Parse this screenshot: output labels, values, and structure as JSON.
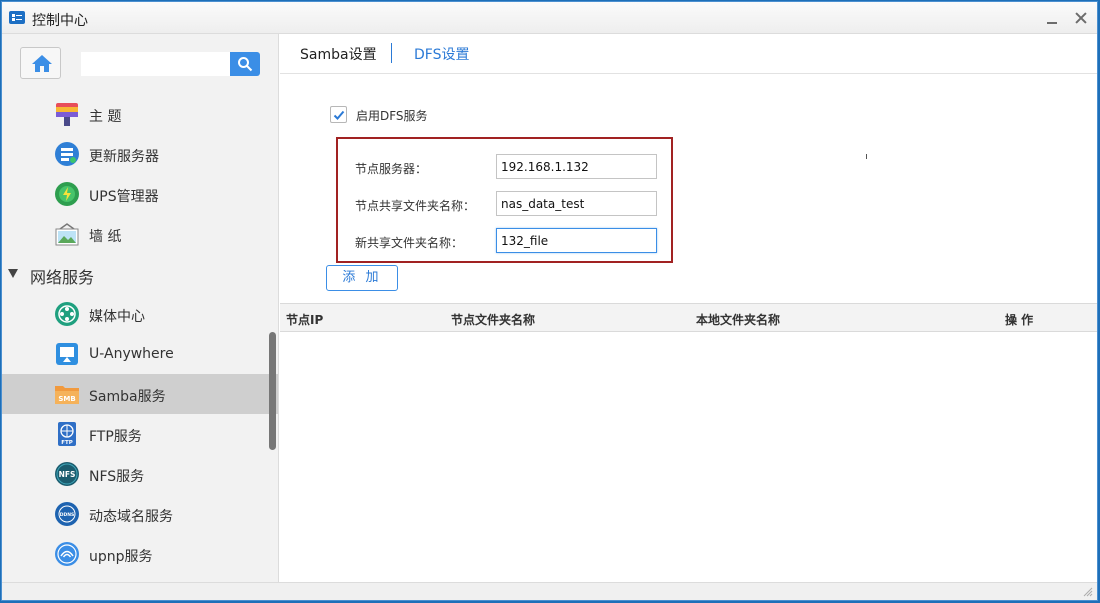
{
  "window": {
    "title": "控制中心"
  },
  "sidebar": {
    "search_placeholder": "",
    "items_top": [
      {
        "label": "主 题",
        "icon": "theme-icon"
      },
      {
        "label": "更新服务器",
        "icon": "update-server-icon"
      },
      {
        "label": "UPS管理器",
        "icon": "ups-icon"
      },
      {
        "label": "墙 纸",
        "icon": "wallpaper-icon"
      }
    ],
    "group": {
      "label": "网络服务",
      "expanded": true
    },
    "items_network": [
      {
        "label": "媒体中心",
        "icon": "media-center-icon"
      },
      {
        "label": "U-Anywhere",
        "icon": "u-anywhere-icon"
      },
      {
        "label": "Samba服务",
        "icon": "smb-icon",
        "icon_text": "SMB",
        "active": true
      },
      {
        "label": "FTP服务",
        "icon": "ftp-icon",
        "icon_text": "FTP"
      },
      {
        "label": "NFS服务",
        "icon": "nfs-icon",
        "icon_text": "NFS"
      },
      {
        "label": "动态域名服务",
        "icon": "ddns-icon",
        "icon_text": "DDNS"
      },
      {
        "label": "upnp服务",
        "icon": "upnp-icon"
      }
    ]
  },
  "tabs": [
    {
      "label": "Samba设置",
      "active": false
    },
    {
      "label": "DFS设置",
      "active": true
    }
  ],
  "dfs": {
    "enable_label": "启用DFS服务",
    "enabled": true,
    "fields": [
      {
        "label": "节点服务器：",
        "value": "192.168.1.132"
      },
      {
        "label": "节点共享文件夹名称：",
        "value": "nas_data_test"
      },
      {
        "label": "新共享文件夹名称：",
        "value": "132_file"
      }
    ],
    "add_button": "添 加"
  },
  "table": {
    "columns": [
      "节点IP",
      "节点文件夹名称",
      "本地文件夹名称",
      "操 作"
    ],
    "rows": []
  },
  "colors": {
    "accent": "#3b8ee6",
    "highlight_box": "#a12222",
    "active_item": "#cfcfcf"
  }
}
